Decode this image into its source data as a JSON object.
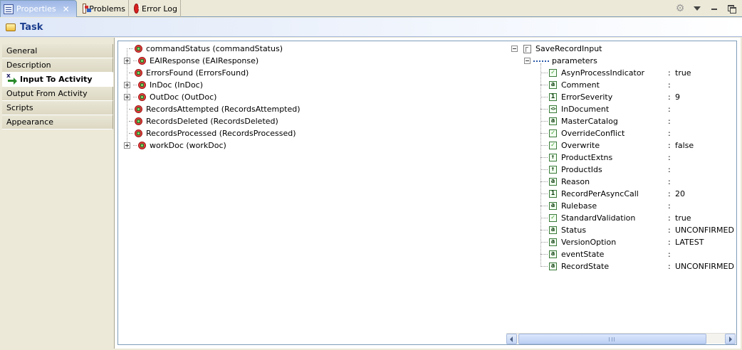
{
  "tabs": {
    "properties": "Properties",
    "problems": "Problems",
    "error_log": "Error Log"
  },
  "title": "Task",
  "sections": [
    {
      "label": "General",
      "active": false
    },
    {
      "label": "Description",
      "active": false
    },
    {
      "label": "Input To Activity",
      "active": true
    },
    {
      "label": "Output From Activity",
      "active": false
    },
    {
      "label": "Scripts",
      "active": false
    },
    {
      "label": "Appearance",
      "active": false
    }
  ],
  "variables": [
    {
      "label": "commandStatus (commandStatus)",
      "expandable": false
    },
    {
      "label": "EAIResponse (EAIResponse)",
      "expandable": true
    },
    {
      "label": "ErrorsFound (ErrorsFound)",
      "expandable": false
    },
    {
      "label": "InDoc (InDoc)",
      "expandable": true
    },
    {
      "label": "OutDoc (OutDoc)",
      "expandable": true
    },
    {
      "label": "RecordsAttempted (RecordsAttempted)",
      "expandable": false
    },
    {
      "label": "RecordsDeleted (RecordsDeleted)",
      "expandable": false
    },
    {
      "label": "RecordsProcessed (RecordsProcessed)",
      "expandable": false
    },
    {
      "label": "workDoc (workDoc)",
      "expandable": true
    }
  ],
  "target": {
    "root": "SaveRecordInput",
    "group": "parameters",
    "params": [
      {
        "name": "AsynProcessIndicator",
        "type": "bool",
        "value": "true"
      },
      {
        "name": "Comment",
        "type": "str",
        "value": ""
      },
      {
        "name": "ErrorSeverity",
        "type": "int",
        "value": "9"
      },
      {
        "name": "InDocument",
        "type": "doc",
        "value": ""
      },
      {
        "name": "MasterCatalog",
        "type": "str",
        "value": ""
      },
      {
        "name": "OverrideConflict",
        "type": "bool",
        "value": ""
      },
      {
        "name": "Overwrite",
        "type": "bool",
        "value": "false"
      },
      {
        "name": "ProductExtns",
        "type": "list",
        "value": ""
      },
      {
        "name": "ProductIds",
        "type": "list",
        "value": ""
      },
      {
        "name": "Reason",
        "type": "str",
        "value": ""
      },
      {
        "name": "RecordPerAsyncCall",
        "type": "int",
        "value": "20"
      },
      {
        "name": "Rulebase",
        "type": "str",
        "value": ""
      },
      {
        "name": "StandardValidation",
        "type": "bool",
        "value": "true"
      },
      {
        "name": "Status",
        "type": "str",
        "value": "UNCONFIRMED"
      },
      {
        "name": "VersionOption",
        "type": "str",
        "value": "LATEST"
      },
      {
        "name": "eventState",
        "type": "str",
        "value": ""
      },
      {
        "name": "RecordState",
        "type": "str",
        "value": "UNCONFIRMED"
      }
    ]
  },
  "icons": {
    "properties": "properties-icon",
    "problems": "problems-icon",
    "error_log": "error-log-icon",
    "task": "task-icon",
    "variable": "process-variable-icon",
    "boolean": "boolean-type-icon",
    "string": "string-type-icon",
    "integer": "integer-type-icon",
    "document": "document-type-icon",
    "list": "list-type-icon"
  },
  "colors": {
    "title_text": "#1d3f8f",
    "active_tab": "#9db6e6",
    "border": "#7f9db9"
  }
}
